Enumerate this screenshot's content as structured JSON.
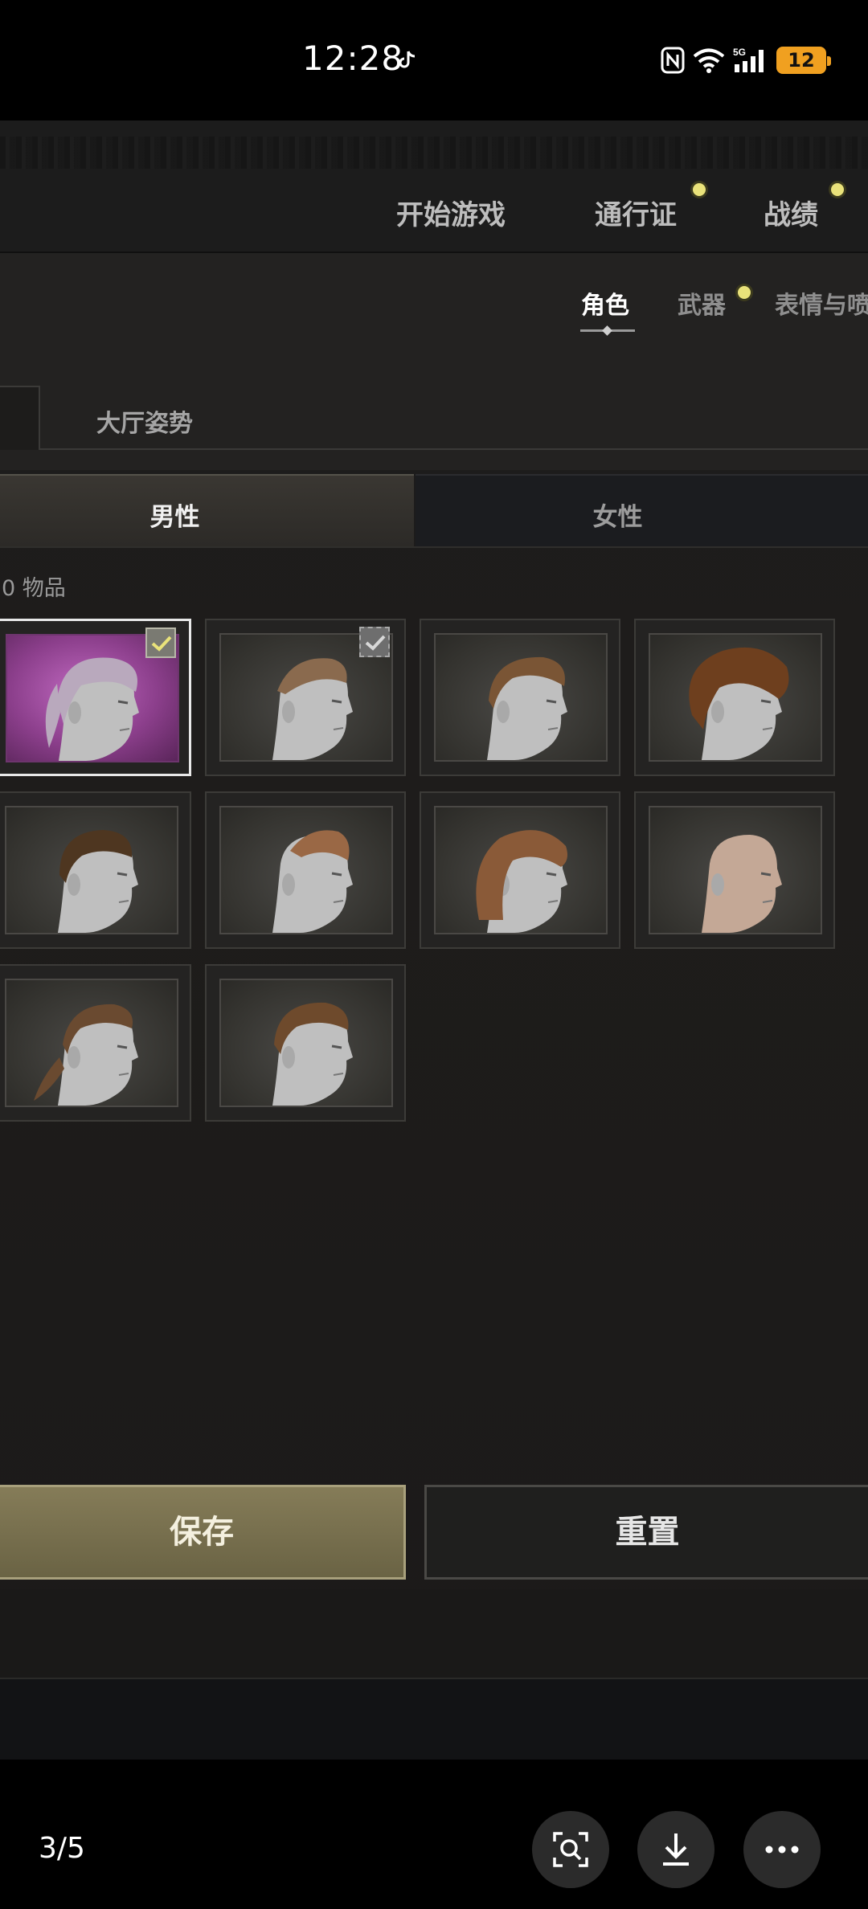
{
  "status_bar": {
    "time": "12:28",
    "battery": "12",
    "network": "5G"
  },
  "top_nav": {
    "start_game": "开始游戏",
    "pass": "通行证",
    "stats": "战绩"
  },
  "sub_nav": {
    "character": "角色",
    "weapons": "武器",
    "emotes": "表情与喷"
  },
  "tabs": {
    "lobby_pose": "大厅姿势"
  },
  "gender": {
    "male": "男性",
    "female": "女性"
  },
  "items_count": "0 物品",
  "hair_items": [
    {
      "style": "purple-ponytail-bangs",
      "checked": "active",
      "selected": true
    },
    {
      "style": "slicked-undercut",
      "checked": "inactive",
      "selected": false
    },
    {
      "style": "side-part",
      "checked": "",
      "selected": false
    },
    {
      "style": "curly-afro",
      "checked": "",
      "selected": false
    },
    {
      "style": "short-curly",
      "checked": "",
      "selected": false
    },
    {
      "style": "side-shave",
      "checked": "",
      "selected": false
    },
    {
      "style": "wavy-long",
      "checked": "",
      "selected": false
    },
    {
      "style": "bald",
      "checked": "",
      "selected": false
    },
    {
      "style": "low-ponytail",
      "checked": "",
      "selected": false
    },
    {
      "style": "short-textured",
      "checked": "",
      "selected": false
    }
  ],
  "buttons": {
    "save": "保存",
    "reset": "重置"
  },
  "viewer": {
    "page_indicator": "3/5"
  },
  "colors": {
    "accent_dot": "#e9e27a",
    "save_button": "#7a7150",
    "selected_bg": "#a14fa1"
  }
}
